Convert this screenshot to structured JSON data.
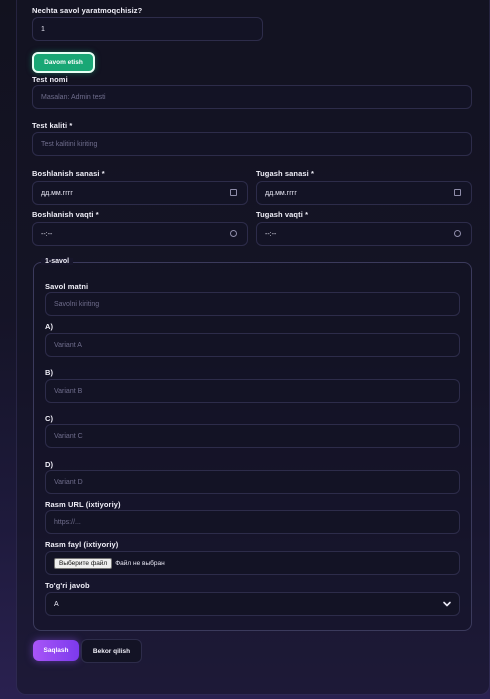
{
  "form": {
    "count_label": "Nechta savol yaratmoqchisiz?",
    "count_value": "1",
    "continue_button": "Davom etish",
    "test_name_label": "Test nomi",
    "test_name_placeholder": "Masalan: Admin testi",
    "test_key_label": "Test kaliti *",
    "test_key_placeholder": "Test kalitini kiriting",
    "start_date_label": "Boshlanish sanasi *",
    "start_date_value": "дд.мм.гггг",
    "end_date_label": "Tugash sanasi *",
    "end_date_value": "дд.мм.гггг",
    "start_time_label": "Boshlanish vaqti *",
    "start_time_value": "--:--",
    "end_time_label": "Tugash vaqti *",
    "end_time_value": "--:--"
  },
  "question": {
    "legend": "1-savol",
    "text_label": "Savol matni",
    "text_placeholder": "Savolni kiriting",
    "a_label": "A)",
    "a_placeholder": "Variant A",
    "b_label": "B)",
    "b_placeholder": "Variant B",
    "c_label": "C)",
    "c_placeholder": "Variant C",
    "d_label": "D)",
    "d_placeholder": "Variant D",
    "image_url_label": "Rasm URL (ixtiyoriy)",
    "image_url_placeholder": "https://...",
    "image_file_label": "Rasm fayl (ixtiyoriy)",
    "file_button": "Выберите файл",
    "file_status": "Файл не выбран",
    "answer_label": "To'g'ri javob",
    "answer_value": "A"
  },
  "actions": {
    "save": "Saqlash",
    "cancel": "Bekor qilish"
  },
  "colors": {
    "accent_green": "#19a775",
    "accent_purple": "#a855f7",
    "background": "#131325"
  }
}
